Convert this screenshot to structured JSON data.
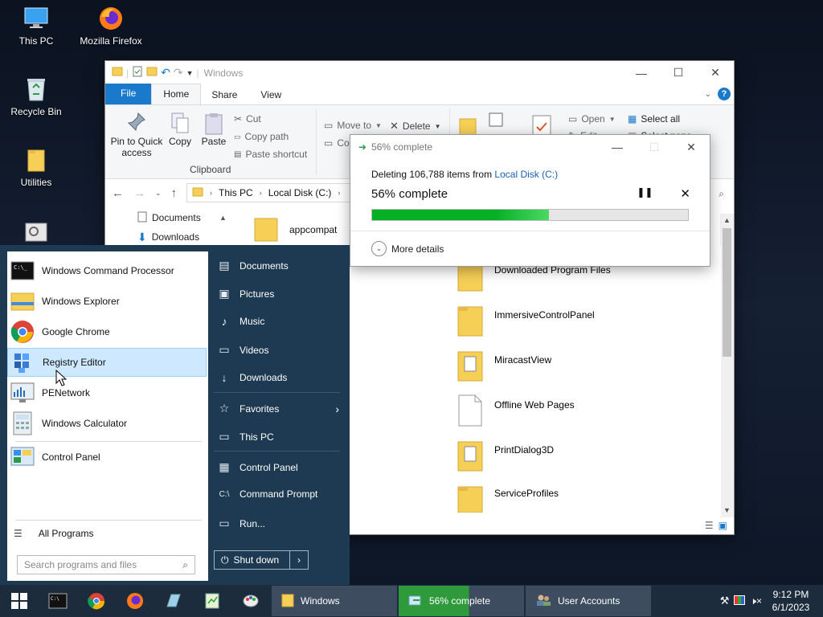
{
  "desktop": {
    "icons": [
      {
        "label": "This PC"
      },
      {
        "label": "Mozilla Firefox"
      },
      {
        "label": "Recycle Bin"
      },
      {
        "label": "Utilities"
      }
    ]
  },
  "explorer": {
    "title": "Windows",
    "tabs": {
      "file": "File",
      "home": "Home",
      "share": "Share",
      "view": "View"
    },
    "ribbon": {
      "pin_label_1": "Pin to Quick",
      "pin_label_2": "access",
      "copy": "Copy",
      "paste": "Paste",
      "cut": "Cut",
      "copy_path": "Copy path",
      "paste_shortcut": "Paste shortcut",
      "clipboard_group": "Clipboard",
      "move_to": "Move to",
      "copy_to_partial": "Cop",
      "delete": "Delete",
      "open": "Open",
      "edit": "Edit",
      "select_all": "Select all",
      "select_none": "Select none"
    },
    "address": {
      "crumbs": [
        "This PC",
        "Local Disk (C:)"
      ]
    },
    "nav_items": [
      {
        "label": "Documents"
      },
      {
        "label": "Downloads"
      }
    ],
    "first_file": "appcompat",
    "files": [
      {
        "name": "Downloaded Program Files",
        "kind": "folder"
      },
      {
        "name": "ImmersiveControlPanel",
        "kind": "folder"
      },
      {
        "name": "MiracastView",
        "kind": "folder-doc"
      },
      {
        "name": "Offline Web Pages",
        "kind": "file"
      },
      {
        "name": "PrintDialog3D",
        "kind": "folder-doc"
      },
      {
        "name": "ServiceProfiles",
        "kind": "folder"
      }
    ]
  },
  "progress_dialog": {
    "title": "56% complete",
    "line_prefix": "Deleting 106,788 items from ",
    "line_link": "Local Disk (C:)",
    "percent_text": "56% complete",
    "percent": 56,
    "more_details": "More details"
  },
  "start_menu": {
    "programs": [
      {
        "label": "Windows Command Processor",
        "icon": "cmd-icon"
      },
      {
        "label": "Windows Explorer",
        "icon": "folder-icon"
      },
      {
        "label": "Google Chrome",
        "icon": "chrome-icon"
      },
      {
        "label": "Registry Editor",
        "icon": "regedit-icon",
        "highlighted": true
      },
      {
        "label": "PENetwork",
        "icon": "network-icon"
      },
      {
        "label": "Windows Calculator",
        "icon": "calculator-icon"
      },
      {
        "label": "Control Panel",
        "icon": "control-panel-icon"
      }
    ],
    "all_programs": "All Programs",
    "search_placeholder": "Search programs and files",
    "right_items": [
      {
        "label": "Documents",
        "icon": "document-icon"
      },
      {
        "label": "Pictures",
        "icon": "picture-icon"
      },
      {
        "label": "Music",
        "icon": "music-icon"
      },
      {
        "label": "Videos",
        "icon": "video-icon"
      },
      {
        "label": "Downloads",
        "icon": "download-icon"
      },
      {
        "label": "Favorites",
        "icon": "star-icon"
      },
      {
        "label": "This PC",
        "icon": "monitor-icon"
      },
      {
        "label": "Control Panel",
        "icon": "control-panel-icon"
      },
      {
        "label": "Command Prompt",
        "icon": "terminal-icon"
      },
      {
        "label": "Run...",
        "icon": "run-icon"
      }
    ],
    "shutdown": "Shut down"
  },
  "taskbar": {
    "tasks": [
      {
        "label": "Windows"
      },
      {
        "label": "56% complete"
      },
      {
        "label": "User Accounts"
      }
    ],
    "time": "9:12 PM",
    "date": "6/1/2023"
  },
  "colors": {
    "accent": "#1979ca",
    "progress": "#06b025",
    "start_bg": "#1e3a52",
    "taskbar_bg": "#1c2c3d"
  }
}
